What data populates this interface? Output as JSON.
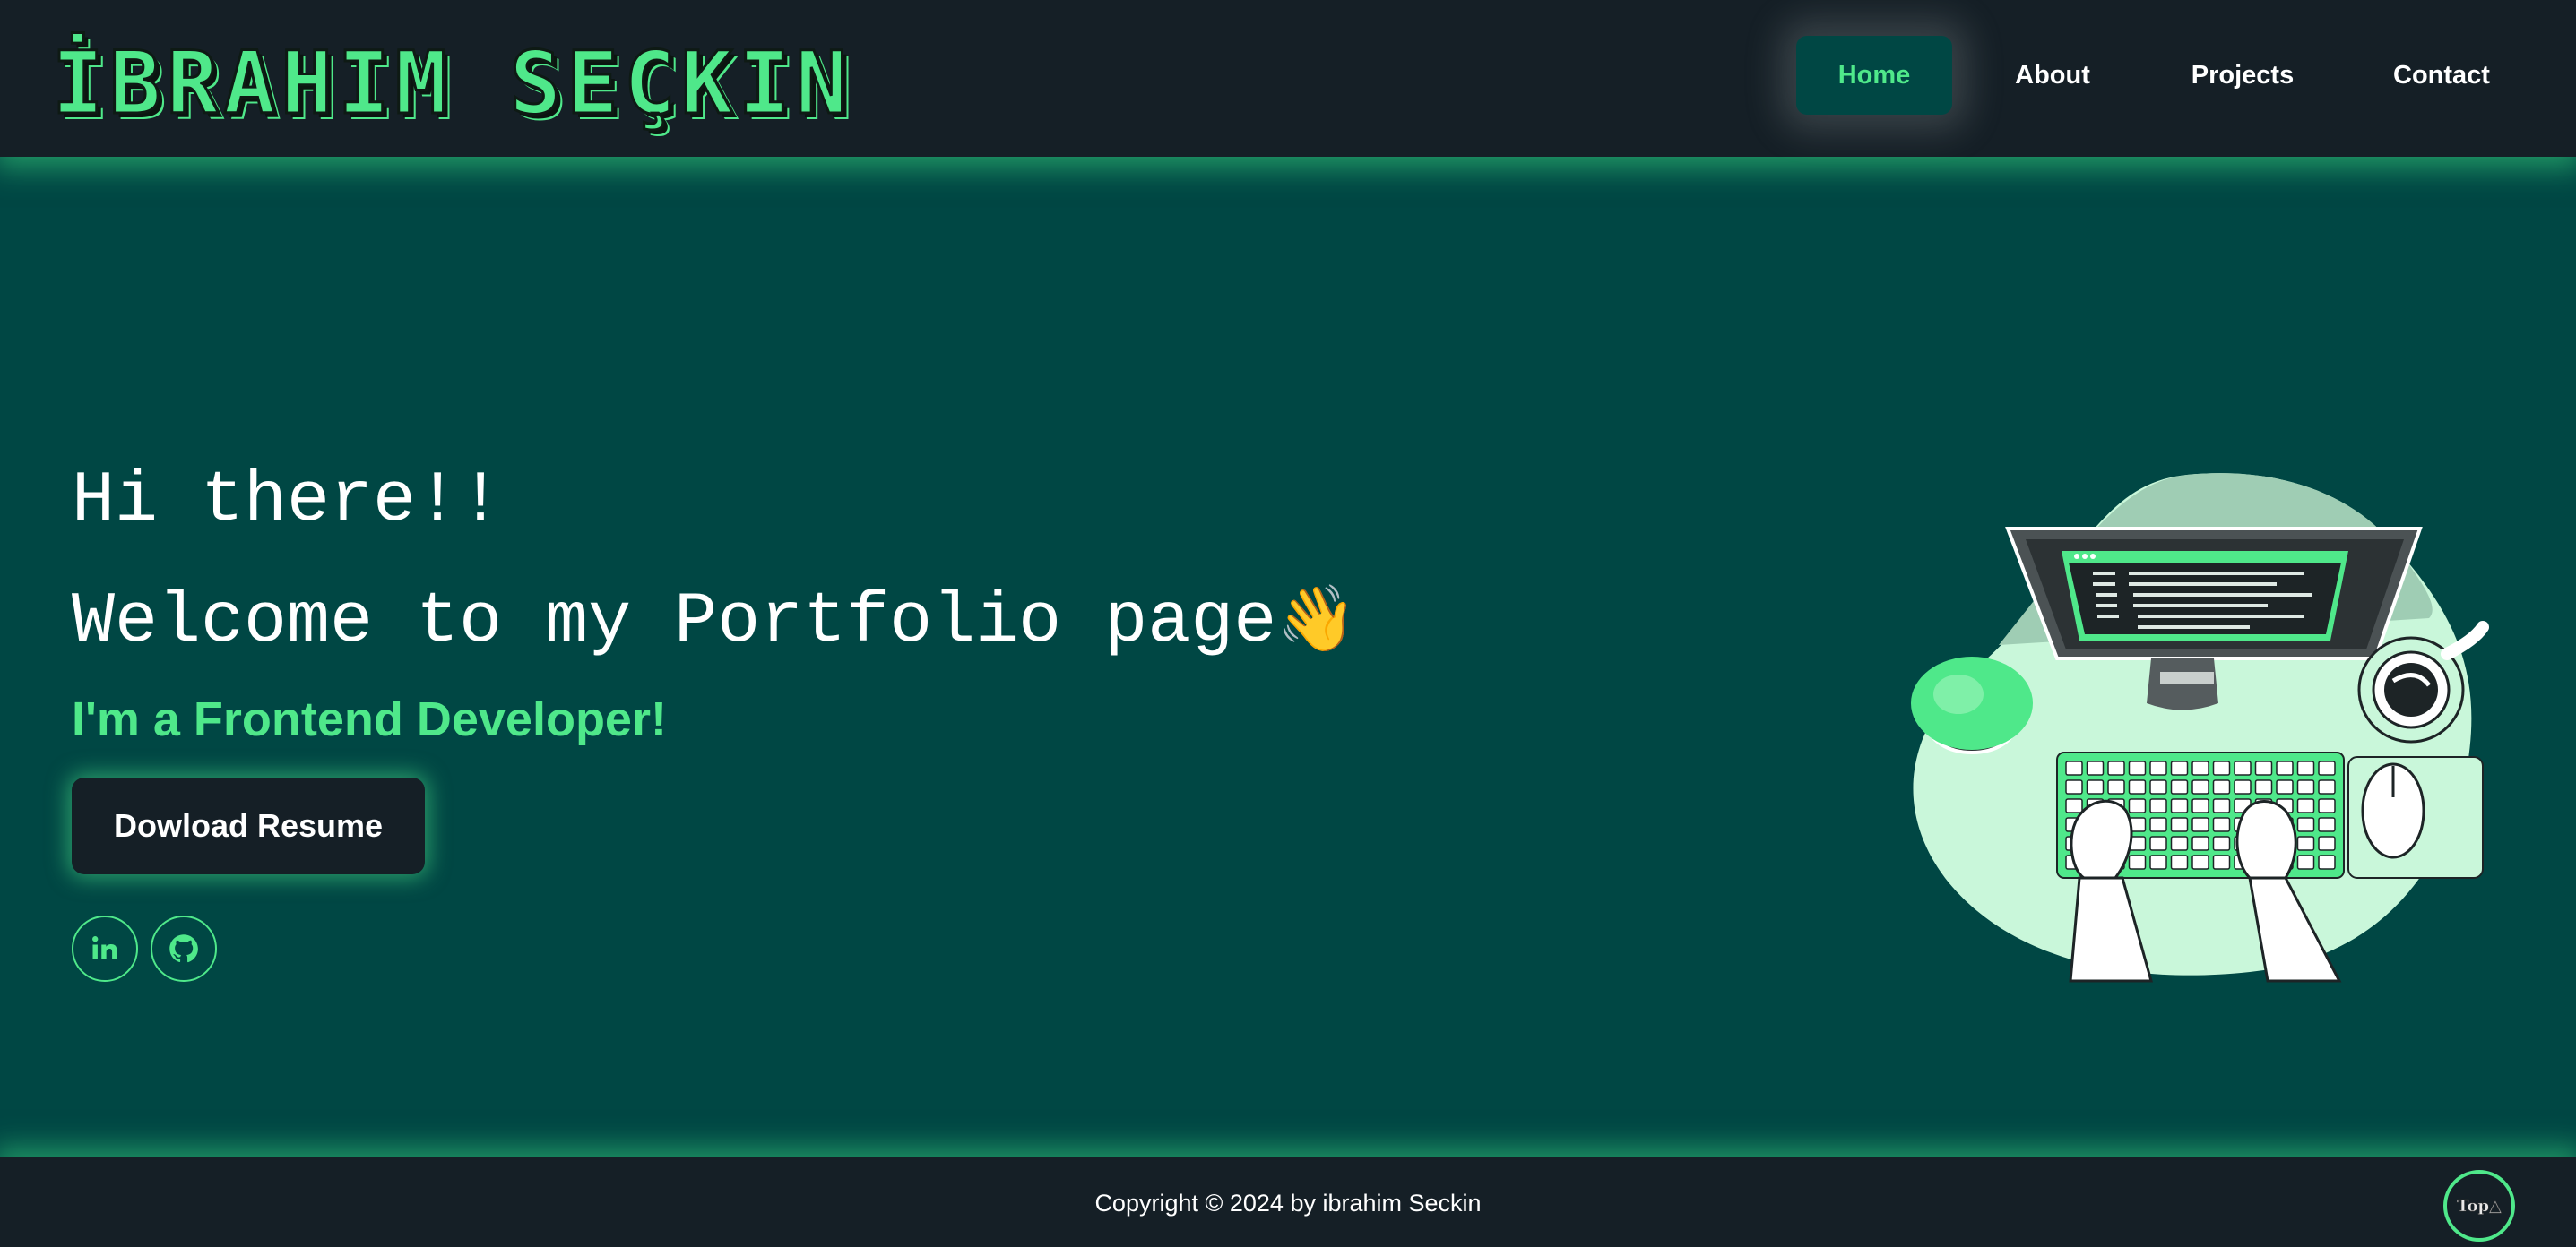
{
  "header": {
    "logo": "İBRAHIM SEÇKIN",
    "nav": [
      {
        "label": "Home",
        "active": true
      },
      {
        "label": "About",
        "active": false
      },
      {
        "label": "Projects",
        "active": false
      },
      {
        "label": "Contact",
        "active": false
      }
    ]
  },
  "hero": {
    "greeting": "Hi there!!",
    "welcome": "Welcome to my Portfolio page",
    "wave_emoji": "👋",
    "role": "I'm a Frontend Developer!",
    "resume_button": "Dowload Resume",
    "socials": [
      {
        "icon": "linkedin-icon",
        "label": "in"
      },
      {
        "icon": "github-icon"
      }
    ],
    "illustration": "developer-at-desk-illustration"
  },
  "footer": {
    "copyright": "Copyright © 2024 by ibrahim Seckin",
    "top_button": "Top△"
  },
  "colors": {
    "accent": "#4fe88a",
    "header_bg": "#151f26",
    "page_bg": "#004744",
    "text": "#ffffff"
  }
}
